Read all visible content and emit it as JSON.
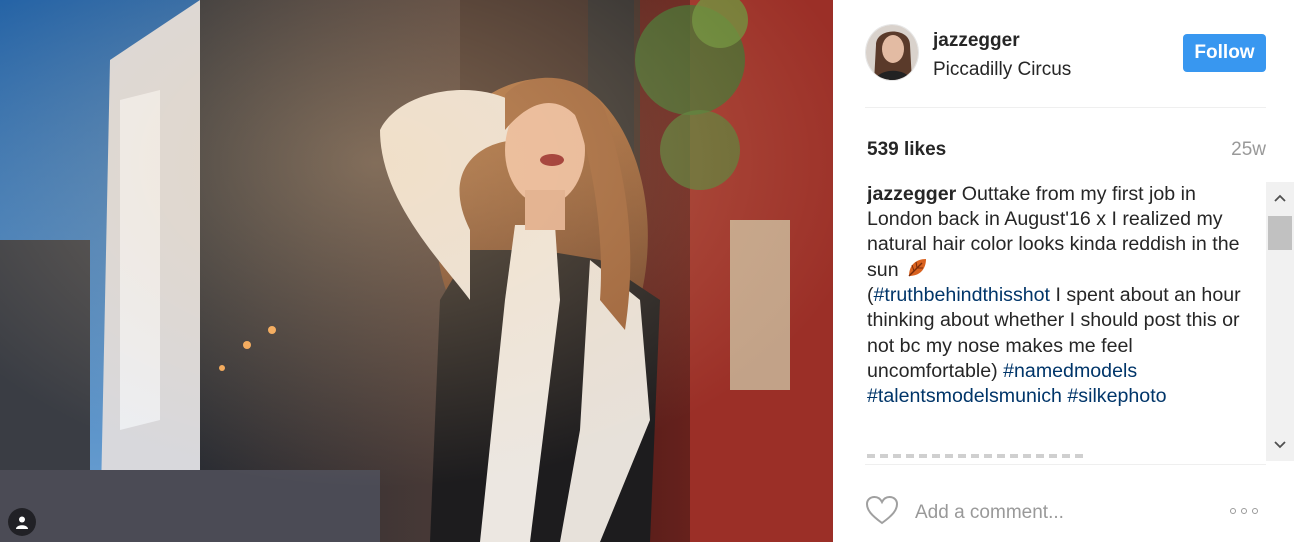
{
  "post": {
    "username": "jazzegger",
    "location": "Piccadilly Circus",
    "follow_label": "Follow",
    "likes": "539 likes",
    "time_ago": "25w"
  },
  "caption": {
    "username": "jazzegger",
    "text_1": " Outtake from my first job in London back in August'16 x I realized my natural hair color looks kinda reddish in the sun ",
    "emoji": "fallen-leaf-icon",
    "text_2": "(",
    "hashtag_1": "#truthbehindthisshot",
    "text_3": " I spent about an hour thinking about whether I should post this or not bc my nose makes me feel uncomfortable) ",
    "hashtag_2": "#namedmodels",
    "hashtag_3": "#talentsmodelsmunich",
    "hashtag_4": "#silkephoto"
  },
  "comment": {
    "placeholder": "Add a comment..."
  },
  "icons": {
    "like": "heart-outline-icon",
    "more": "more-options-icon",
    "scroll_up": "chevron-up-icon",
    "scroll_down": "chevron-down-icon",
    "tag": "user-tag-icon"
  },
  "colors": {
    "follow_bg": "#3897f0",
    "hashtag": "#003569",
    "muted": "#999999"
  }
}
